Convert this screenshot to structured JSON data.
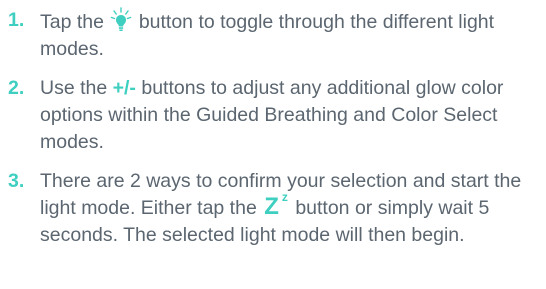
{
  "steps": [
    {
      "number": "1.",
      "text_before_icon": "Tap the",
      "icon": "lightbulb-icon",
      "text_after_icon": "button to toggle through the different light modes."
    },
    {
      "number": "2.",
      "text_before": "Use the",
      "highlight": "+/-",
      "text_after": "buttons to adjust any additional glow color options within the Guided Breathing and Color Select modes."
    },
    {
      "number": "3.",
      "text_before_icon": "There are 2 ways to confirm your selection and start the light mode. Either tap the",
      "icon": "sleep-zz-icon",
      "icon_text_large": "Z",
      "icon_text_small": "z",
      "text_after_icon": "button or simply wait 5 seconds. The selected light mode will then begin."
    }
  ],
  "colors": {
    "text": "#5b6670",
    "accent": "#3ecfc0"
  }
}
